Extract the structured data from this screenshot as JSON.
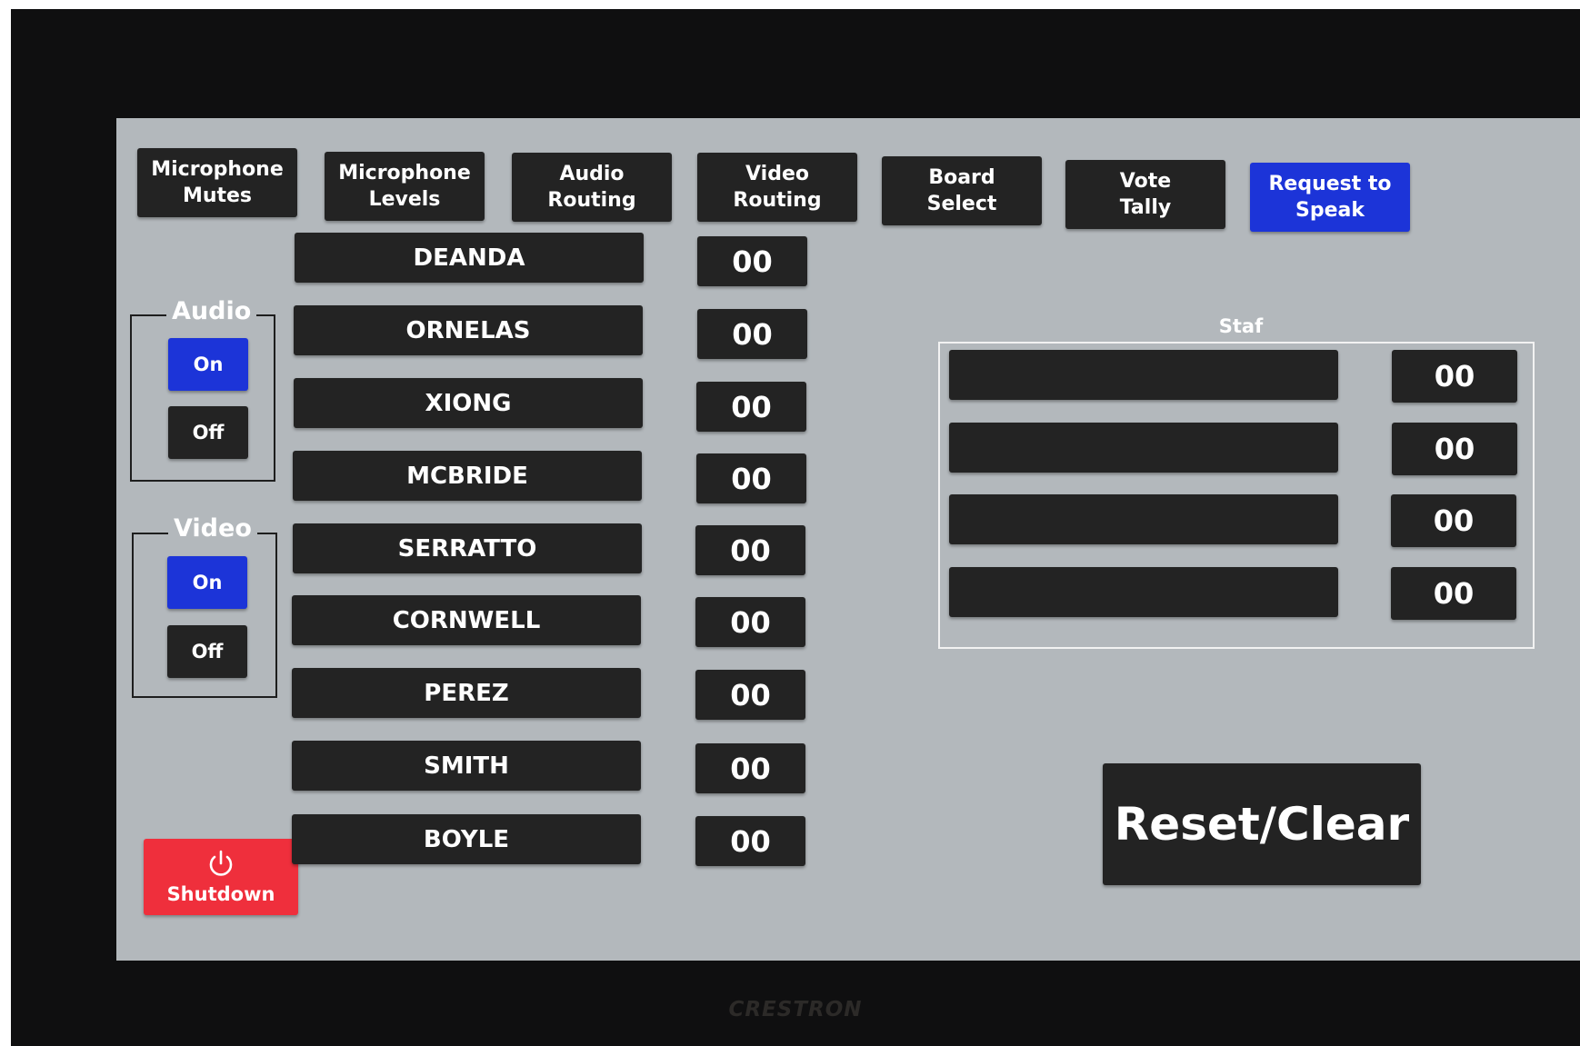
{
  "device": {
    "brand": "CRESTRON"
  },
  "tabs": [
    {
      "label": "Microphone\nMutes",
      "active": false
    },
    {
      "label": "Microphone\nLevels",
      "active": false
    },
    {
      "label": "Audio\nRouting",
      "active": false
    },
    {
      "label": "Video\nRouting",
      "active": false
    },
    {
      "label": "Board\nSelect",
      "active": false
    },
    {
      "label": "Vote\nTally",
      "active": false
    },
    {
      "label": "Request to\nSpeak",
      "active": true
    }
  ],
  "audio": {
    "legend": "Audio",
    "on_label": "On",
    "off_label": "Off",
    "state": "On"
  },
  "video": {
    "legend": "Video",
    "on_label": "On",
    "off_label": "Off",
    "state": "On"
  },
  "shutdown": {
    "label": "Shutdown",
    "icon": "power-icon"
  },
  "members": [
    {
      "name": "DEANDA",
      "count": "00"
    },
    {
      "name": "ORNELAS",
      "count": "00"
    },
    {
      "name": "XIONG",
      "count": "00"
    },
    {
      "name": "MCBRIDE",
      "count": "00"
    },
    {
      "name": "SERRATTO",
      "count": "00"
    },
    {
      "name": "CORNWELL",
      "count": "00"
    },
    {
      "name": "PEREZ",
      "count": "00"
    },
    {
      "name": "SMITH",
      "count": "00"
    },
    {
      "name": "BOYLE",
      "count": "00"
    }
  ],
  "staff": {
    "label": "Staf",
    "rows": [
      {
        "name": "",
        "count": "00"
      },
      {
        "name": "",
        "count": "00"
      },
      {
        "name": "",
        "count": "00"
      },
      {
        "name": "",
        "count": "00"
      }
    ]
  },
  "reset": {
    "label": "Reset/Clear"
  },
  "colors": {
    "panel": "#b3b8bc",
    "button": "#232323",
    "active": "#1c34d8",
    "shutdown": "#ef2f3c"
  }
}
